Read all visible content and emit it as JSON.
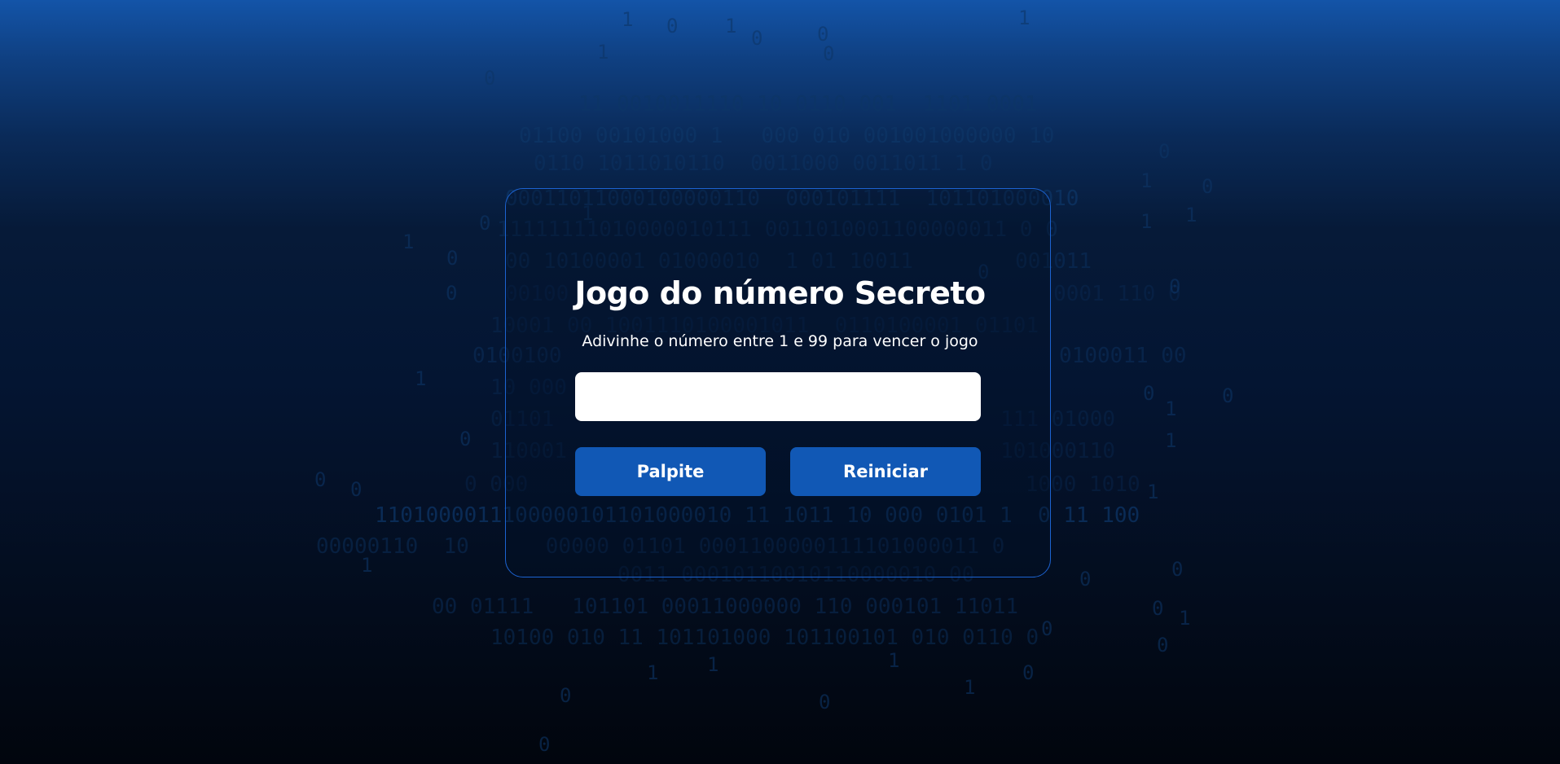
{
  "game": {
    "title": "Jogo do número Secreto",
    "subtitle": "Adivinhe o número entre 1 e 99 para vencer o jogo",
    "input_value": "",
    "guess_button_label": "Palpite",
    "reset_button_label": "Reiniciar"
  },
  "colors": {
    "button_background": "#1158b5",
    "panel_border": "#1c63d1",
    "text": "#ffffff",
    "background_top": "#1354a8",
    "background_bottom": "#01050d"
  }
}
